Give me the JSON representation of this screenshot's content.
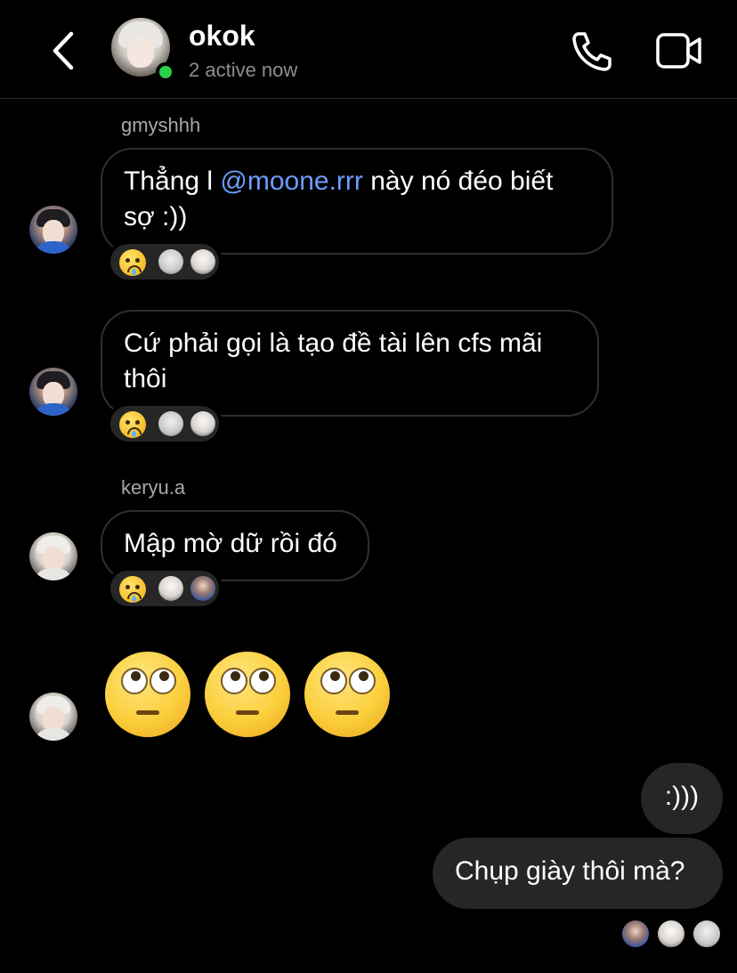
{
  "header": {
    "title": "okok",
    "subtitle": "2 active now",
    "back_icon": "chevron-left-icon",
    "call_icon": "phone-icon",
    "video_icon": "video-camera-icon",
    "online_color": "#2bd04a"
  },
  "messages": [
    {
      "sender": "gmyshhh",
      "text_before": "Thẳng l ",
      "mention": "@moone.rrr",
      "text_after": " này nó đéo biết sợ :))",
      "reaction": "crying-face-emoji"
    },
    {
      "sender": "",
      "text": "Cứ phải gọi là tạo đề tài lên cfs mãi thôi",
      "reaction": "crying-face-emoji"
    },
    {
      "sender": "keryu.a",
      "text": "Mập mờ dữ rồi đó",
      "reaction": "crying-face-emoji"
    },
    {
      "sender": "",
      "emoji": [
        "face-with-rolling-eyes",
        "face-with-rolling-eyes",
        "face-with-rolling-eyes"
      ]
    }
  ],
  "outgoing": [
    {
      "text": ":)))"
    },
    {
      "text": "Chụp giày thôi mà?"
    }
  ],
  "colors": {
    "background": "#000000",
    "bubble_out": "#262626",
    "bubble_in_border": "#2f2f2f",
    "mention": "#6d9cff",
    "secondary_text": "#8e8e8e"
  }
}
